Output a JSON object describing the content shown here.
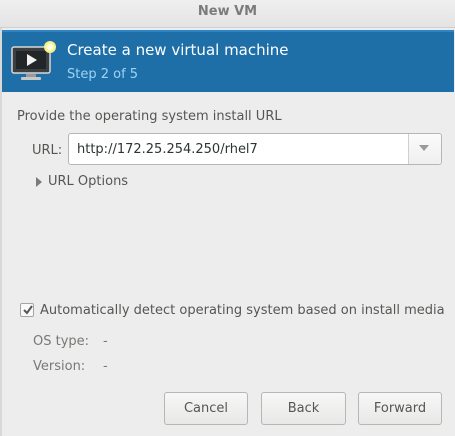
{
  "window": {
    "title": "New VM"
  },
  "header": {
    "title": "Create a new virtual machine",
    "step": "Step 2 of 5",
    "icon": "vm-monitor-icon",
    "colors": {
      "banner": "#1e6fa8",
      "step_text": "#9fd3f5"
    }
  },
  "form": {
    "section_label": "Provide the operating system install URL",
    "url_label": "URL:",
    "url_value": "http://172.25.254.250/rhel7",
    "url_options_label": "URL Options",
    "auto_detect_label": "Automatically detect operating system based on install media",
    "auto_detect_checked": true,
    "os_type_label": "OS type:",
    "os_type_value": "-",
    "version_label": "Version:",
    "version_value": "-"
  },
  "buttons": {
    "cancel": "Cancel",
    "back": "Back",
    "forward": "Forward"
  }
}
